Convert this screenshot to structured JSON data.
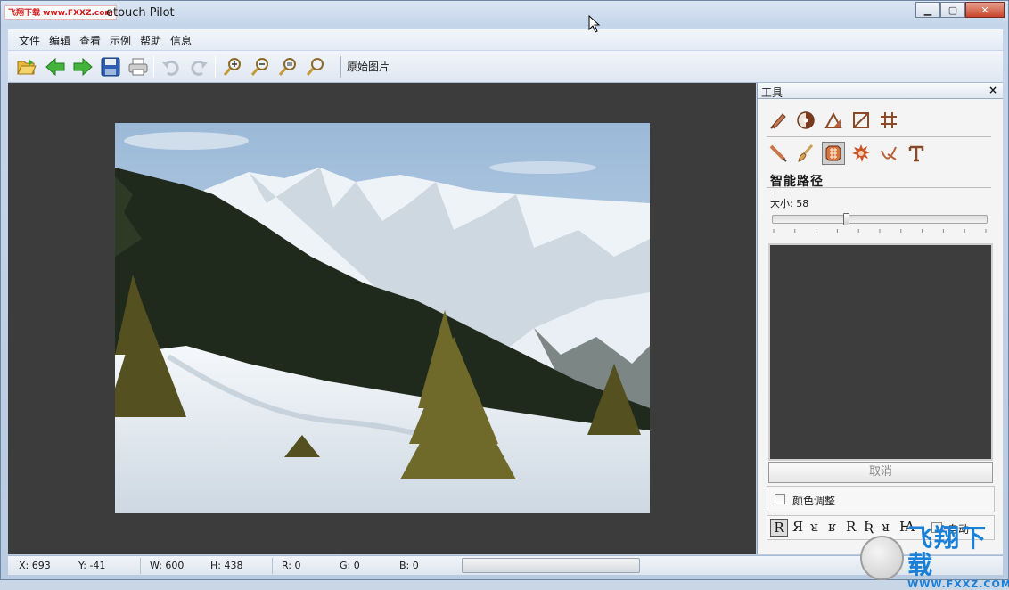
{
  "window": {
    "title": "etouch Pilot",
    "logo_text": "飞翔下载 www.FXXZ.com",
    "minimize_label": "▁",
    "maximize_label": "▢",
    "close_label": "✕"
  },
  "menu": {
    "items": [
      "文件",
      "编辑",
      "查看",
      "示例",
      "帮助",
      "信息"
    ]
  },
  "toolbar": {
    "icons": [
      "open-icon",
      "back-arrow-icon",
      "forward-arrow-icon",
      "save-icon",
      "print-icon",
      "undo-icon",
      "redo-icon",
      "zoom-in-icon",
      "zoom-out-icon",
      "zoom-fit-icon",
      "zoom-actual-icon"
    ],
    "original_image_label": "原始图片"
  },
  "panel": {
    "title": "工具",
    "close_label": "×",
    "row1_icons": [
      "retouch-brush-icon",
      "color-wheel-icon",
      "triangle-ruler-icon",
      "crop-icon",
      "grid-icon"
    ],
    "row2_icons": [
      "pencil-icon",
      "paintbrush-icon",
      "smart-path-icon",
      "gear-burst-icon",
      "pen-tool-icon",
      "text-icon"
    ],
    "selected_tool": "smart-path-icon",
    "section_title": "智能路径",
    "size_label": "大小: 58",
    "size_value": 58,
    "cancel_label": "取消",
    "color_adjust_label": "颜色调整",
    "auto_label": "自动",
    "orientation_glyphs": [
      "R",
      "Я",
      "ᴚ",
      "ʁ",
      "R",
      "Ʀ",
      "ᴚ",
      "Ꙗ"
    ]
  },
  "status": {
    "x": "X: 693",
    "y": "Y: -41",
    "w": "W: 600",
    "h": "H: 438",
    "r": "R: 0",
    "g": "G: 0",
    "b": "B: 0"
  },
  "watermark": {
    "big": "飞翔下载",
    "small": "WWW.FXXZ.COM"
  },
  "colors": {
    "canvas_bg": "#3c3c3c",
    "window_frame": "#c7d6ea",
    "accent_green": "#3aa635",
    "watermark_blue": "#1a7fd6"
  }
}
